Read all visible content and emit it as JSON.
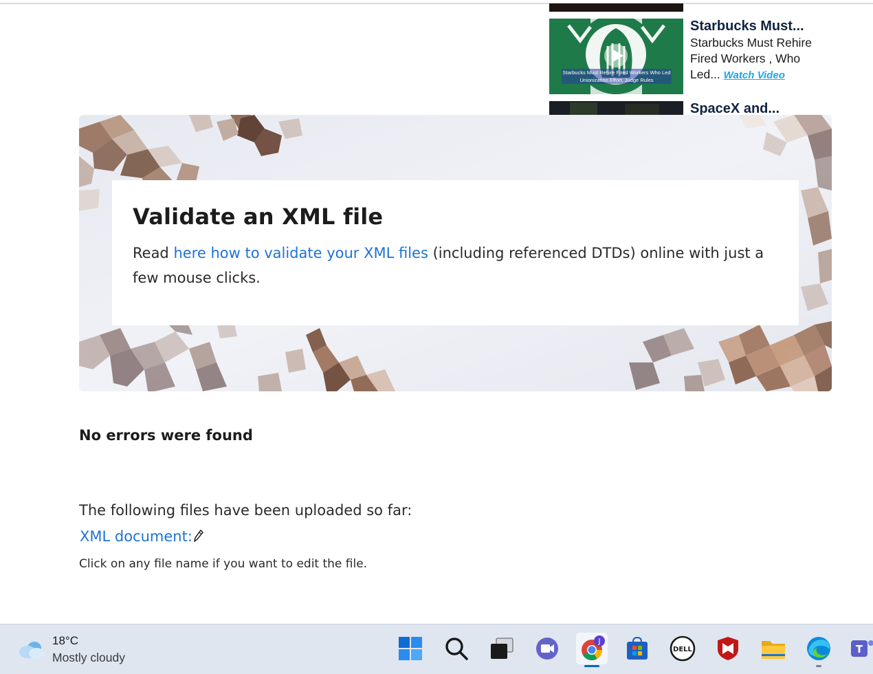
{
  "videos": [
    {
      "title": "Starbucks Must...",
      "description": "Starbucks Must Rehire Fired Workers , Who Led...",
      "watch_label": "Watch Video",
      "thumbnail_caption": "Starbucks Must Rehire Fired Workers Who Led Unionization Effort, Judge Rules"
    },
    {
      "title": "SpaceX and..."
    }
  ],
  "hero": {
    "title": "Validate an XML file",
    "text_before": "Read ",
    "link_text": "here how to validate your XML files",
    "text_after": " (including referenced DTDs) online with just a few mouse clicks."
  },
  "status": {
    "message": "No errors were found"
  },
  "files": {
    "intro": "The following files have been uploaded so far:",
    "items": [
      {
        "label": "XML document:"
      }
    ],
    "hint": "Click on any file name if you want to edit the file."
  },
  "taskbar": {
    "weather": {
      "temp": "18°C",
      "condition": "Mostly cloudy"
    },
    "apps": [
      {
        "name": "start",
        "icon": "windows-start-icon"
      },
      {
        "name": "search",
        "icon": "search-icon"
      },
      {
        "name": "task-view",
        "icon": "task-view-icon"
      },
      {
        "name": "teams-chat",
        "icon": "video-chat-icon"
      },
      {
        "name": "chrome",
        "icon": "chrome-icon",
        "badge": "J",
        "active": true
      },
      {
        "name": "microsoft-store",
        "icon": "store-icon"
      },
      {
        "name": "dell",
        "icon": "dell-icon",
        "label": "DELL"
      },
      {
        "name": "mcafee",
        "icon": "mcafee-icon"
      },
      {
        "name": "file-explorer",
        "icon": "folder-icon"
      },
      {
        "name": "edge",
        "icon": "edge-icon"
      },
      {
        "name": "teams",
        "icon": "teams-icon",
        "label": "T"
      }
    ],
    "colors": {
      "accent": "#0067c0",
      "chrome_badge": "#5b3fd1",
      "mcafee": "#c01818"
    }
  }
}
